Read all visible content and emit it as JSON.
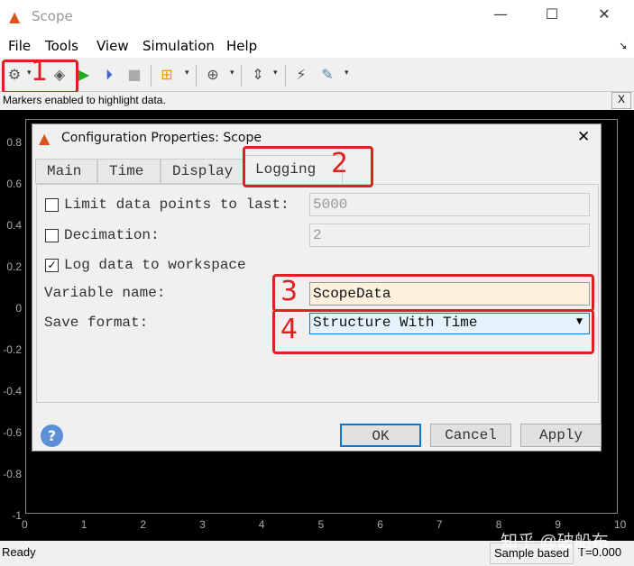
{
  "window": {
    "title": "Scope",
    "minimize": "—",
    "maximize": "☐",
    "close": "✕"
  },
  "menu": [
    "File",
    "Tools",
    "View",
    "Simulation",
    "Help"
  ],
  "toolbar": {
    "icons": [
      "gear-icon",
      "highlight-icon",
      "run-icon",
      "step-forward-icon",
      "stop-icon",
      "signal-icon",
      "zoom-in-icon",
      "scale-axes-icon",
      "triggers-icon",
      "measurements-icon"
    ]
  },
  "message": {
    "text": "Markers enabled to highlight data.",
    "close": "X"
  },
  "plot": {
    "y_ticks": [
      "0.8",
      "0.6",
      "0.4",
      "0.2",
      "0",
      "-0.2",
      "-0.4",
      "-0.6",
      "-0.8",
      "-1"
    ],
    "x_ticks": [
      "0",
      "1",
      "2",
      "3",
      "4",
      "5",
      "6",
      "7",
      "8",
      "9",
      "10"
    ],
    "background": "#000000"
  },
  "annotations": [
    "1",
    "2",
    "3",
    "4"
  ],
  "dialog": {
    "title": "Configuration Properties: Scope",
    "close": "✕",
    "tabs": [
      "Main",
      "Time",
      "Display",
      "Logging"
    ],
    "active_tab": "Logging",
    "limit_label": "Limit data points to last:",
    "limit_checked": false,
    "limit_value": "5000",
    "decimation_label": "Decimation:",
    "decimation_checked": false,
    "decimation_value": "2",
    "log_label": "Log data to workspace",
    "log_checked": true,
    "log_check": "✓",
    "varname_label": "Variable name:",
    "varname_value": "ScopeData",
    "format_label": "Save format:",
    "format_value": "Structure With Time",
    "help": "?",
    "ok": "OK",
    "cancel": "Cancel",
    "apply": "Apply"
  },
  "status": {
    "left": "Ready",
    "mode": "Sample based",
    "time": "T=0.000"
  },
  "watermark": "知乎 @破船布"
}
